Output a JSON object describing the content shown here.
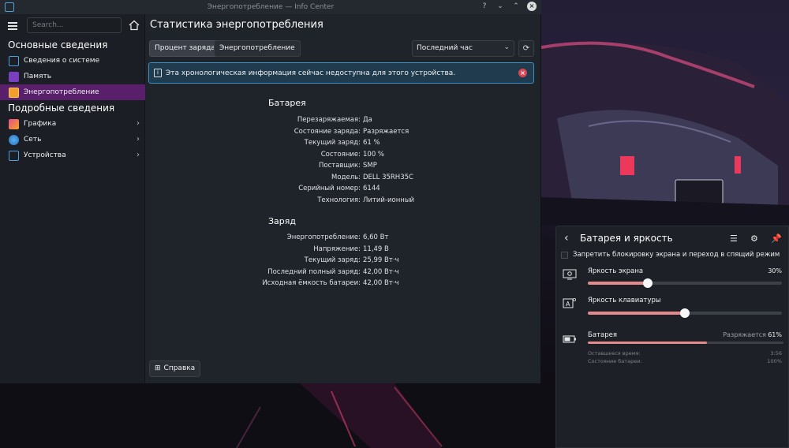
{
  "window": {
    "title": "Энергопотребление — Info Center",
    "controls": [
      "?",
      "⌄",
      "⌃",
      "×"
    ]
  },
  "sidebar": {
    "search_placeholder": "Search...",
    "section_basic": "Основные сведения",
    "section_detailed": "Подробные сведения",
    "items": [
      {
        "label": "Сведения о системе",
        "icon": "info-icon"
      },
      {
        "label": "Память",
        "icon": "memory-icon"
      },
      {
        "label": "Энергопотребление",
        "icon": "energy-icon",
        "active": true
      },
      {
        "label": "Графика",
        "icon": "graphics-icon"
      },
      {
        "label": "Сеть",
        "icon": "network-icon"
      },
      {
        "label": "Устройства",
        "icon": "devices-icon"
      }
    ]
  },
  "content": {
    "title": "Статистика энергопотребления",
    "tabs": [
      "Процент заряда",
      "Энергопотребление"
    ],
    "period": "Последний час",
    "notice": "Эта хронологическая информация сейчас недоступна для этого устройства.",
    "battery_title": "Батарея",
    "battery": [
      {
        "k": "Перезаряжаемая:",
        "v": "Да"
      },
      {
        "k": "Состояние заряда:",
        "v": "Разряжается"
      },
      {
        "k": "Текущий заряд:",
        "v": "61 %"
      },
      {
        "k": "Состояние:",
        "v": "100 %"
      },
      {
        "k": "Поставщик:",
        "v": "SMP"
      },
      {
        "k": "Модель:",
        "v": "DELL 35RH35C"
      },
      {
        "k": "Серийный номер:",
        "v": "6144"
      },
      {
        "k": "Технология:",
        "v": "Литий-ионный"
      }
    ],
    "charge_title": "Заряд",
    "charge": [
      {
        "k": "Энергопотребление:",
        "v": "6,60 Вт"
      },
      {
        "k": "Напряжение:",
        "v": "11,49 В"
      },
      {
        "k": "Текущий заряд:",
        "v": "25,99 Вт·ч"
      },
      {
        "k": "Последний полный заряд:",
        "v": "42,00 Вт·ч"
      },
      {
        "k": "Исходная ёмкость батареи:",
        "v": "42,00 Вт·ч"
      }
    ],
    "help": "Справка"
  },
  "popup": {
    "title": "Батарея и яркость",
    "inhibit_label": "Запретить блокировку экрана и переход в спящий режим",
    "screen_brightness_label": "Яркость экрана",
    "screen_brightness_value": "30%",
    "screen_brightness_fraction": 0.31,
    "keyboard_brightness_label": "Яркость клавиатуры",
    "keyboard_brightness_fraction": 0.5,
    "battery_label": "Батарея",
    "battery_state": "Разряжается",
    "battery_percent": "61%",
    "battery_fraction": 0.61,
    "remaining_label": "Оставшееся время:",
    "remaining_value": "3:56",
    "health_label": "Состояние батареи:",
    "health_value": "100%"
  },
  "colors": {
    "accent_active": "#5a1f6b",
    "slider_fill": "#e58a8a",
    "notice_border": "#3a8fc4",
    "close_red": "#da4453"
  }
}
